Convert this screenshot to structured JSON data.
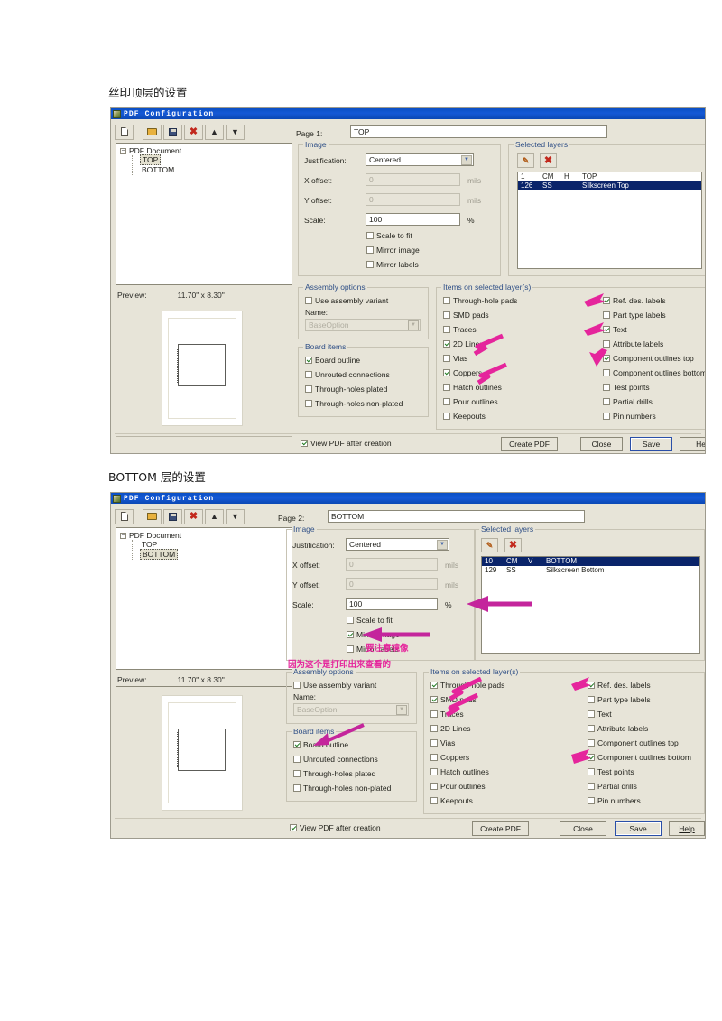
{
  "captions": {
    "top": "丝印顶层的设置",
    "bottom": "BOTTOM 层的设置"
  },
  "window": {
    "title": "PDF Configuration",
    "toolbar": [
      {
        "name": "new",
        "icon": "new-document-icon"
      },
      {
        "name": "open",
        "icon": "open-folder-icon"
      },
      {
        "name": "save",
        "icon": "save-disk-icon"
      },
      {
        "name": "delete",
        "icon": "delete-x-icon",
        "glyph": "✖"
      },
      {
        "name": "move-up",
        "icon": "arrow-up-icon",
        "glyph": "⬆"
      },
      {
        "name": "move-down",
        "icon": "arrow-down-icon",
        "glyph": "⬇"
      }
    ],
    "tree": {
      "root": "PDF Document",
      "children": [
        "TOP",
        "BOTTOM"
      ]
    },
    "preview": {
      "label": "Preview:",
      "size": "11.70\" x 8.30\""
    },
    "image_group": {
      "legend": "Image",
      "justification_label": "Justification:",
      "justification_value": "Centered",
      "xoffset_label": "X offset:",
      "xoffset_value": "0",
      "xoffset_units": "mils",
      "yoffset_label": "Y offset:",
      "yoffset_value": "0",
      "yoffset_units": "mils",
      "scale_label": "Scale:",
      "scale_value": "100",
      "scale_units": "%",
      "checks": [
        "Scale to fit",
        "Mirror image",
        "Mirror labels"
      ]
    },
    "assembly_group": {
      "legend": "Assembly options",
      "use_variant": "Use assembly variant",
      "name_label": "Name:",
      "name_value": "BaseOption"
    },
    "board_group": {
      "legend": "Board items",
      "items": [
        "Board outline",
        "Unrouted connections",
        "Through-holes plated",
        "Through-holes non-plated"
      ]
    },
    "items_group": {
      "legend": "Items on selected layer(s)",
      "left": [
        "Through-hole pads",
        "SMD pads",
        "Traces",
        "2D Lines",
        "Vias",
        "Coppers",
        "Hatch outlines",
        "Pour outlines",
        "Keepouts"
      ],
      "right": [
        "Ref. des. labels",
        "Part type labels",
        "Text",
        "Attribute labels",
        "Component outlines top",
        "Component outlines bottom",
        "Test points",
        "Partial drills",
        "Pin numbers"
      ]
    },
    "layers_group": {
      "legend": "Selected layers",
      "edit_icon": "edit-layer-icon",
      "delete_icon": "delete-layer-icon"
    },
    "view_pdf": "View PDF after creation",
    "buttons": {
      "create": "Create PDF",
      "close": "Close",
      "save": "Save",
      "help": "Help",
      "help_clipped": "He"
    }
  },
  "dialog1": {
    "page_label": "Page 1:",
    "page_value": "TOP",
    "tree_selected": "TOP",
    "layers": [
      {
        "num": "1",
        "code": "CM",
        "dir": "H",
        "name": "TOP",
        "selected": false
      },
      {
        "num": "126",
        "code": "SS",
        "dir": "",
        "name": "Silkscreen Top",
        "selected": true
      }
    ],
    "image_checks": {
      "Scale to fit": false,
      "Mirror image": false,
      "Mirror labels": false
    },
    "assembly_variant": false,
    "board_checks": [
      true,
      false,
      false,
      false
    ],
    "items_left_checks": [
      false,
      false,
      false,
      true,
      false,
      true,
      false,
      false,
      false
    ],
    "items_right_checks": [
      true,
      false,
      true,
      false,
      true,
      false,
      false,
      false,
      false
    ],
    "view_pdf_checked": true
  },
  "dialog2": {
    "page_label": "Page 2:",
    "page_value": "BOTTOM",
    "tree_selected": "BOTTOM",
    "layers": [
      {
        "num": "10",
        "code": "CM",
        "dir": "V",
        "name": "BOTTOM",
        "selected": true
      },
      {
        "num": "129",
        "code": "SS",
        "dir": "",
        "name": "Silkscreen Bottom",
        "selected": false
      }
    ],
    "image_checks": {
      "Scale to fit": false,
      "Mirror image": true,
      "Mirror labels": false
    },
    "assembly_variant": false,
    "board_checks": [
      true,
      false,
      false,
      false
    ],
    "items_left_checks": [
      true,
      true,
      false,
      false,
      false,
      false,
      false,
      false,
      false
    ],
    "items_right_checks": [
      true,
      false,
      false,
      false,
      false,
      true,
      false,
      false,
      false
    ],
    "view_pdf_checked": true,
    "annotations": [
      "要注意镜像",
      "因为这个是打印出来查看的"
    ]
  },
  "colors": {
    "annotation": "#e5259c",
    "titlebar": "#0b4fc6",
    "selection": "#0a246a",
    "dialog_face": "#e7e4d8"
  }
}
